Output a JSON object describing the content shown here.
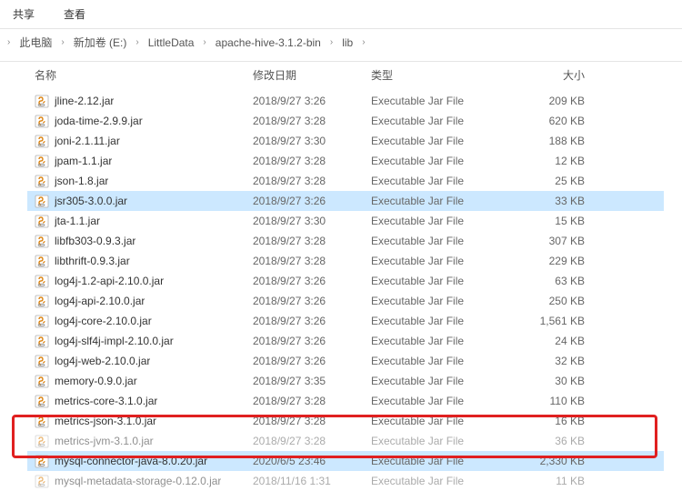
{
  "menubar": [
    {
      "label": "共享"
    },
    {
      "label": "查看"
    }
  ],
  "breadcrumb": [
    "此电脑",
    "新加卷 (E:)",
    "LittleData",
    "apache-hive-3.1.2-bin",
    "lib"
  ],
  "columns": {
    "name": "名称",
    "date": "修改日期",
    "type": "类型",
    "size": "大小"
  },
  "files": [
    {
      "name": "jline-2.12.jar",
      "date": "2018/9/27 3:26",
      "type": "Executable Jar File",
      "size": "209 KB",
      "selected": false
    },
    {
      "name": "joda-time-2.9.9.jar",
      "date": "2018/9/27 3:28",
      "type": "Executable Jar File",
      "size": "620 KB",
      "selected": false
    },
    {
      "name": "joni-2.1.11.jar",
      "date": "2018/9/27 3:30",
      "type": "Executable Jar File",
      "size": "188 KB",
      "selected": false
    },
    {
      "name": "jpam-1.1.jar",
      "date": "2018/9/27 3:28",
      "type": "Executable Jar File",
      "size": "12 KB",
      "selected": false
    },
    {
      "name": "json-1.8.jar",
      "date": "2018/9/27 3:28",
      "type": "Executable Jar File",
      "size": "25 KB",
      "selected": false
    },
    {
      "name": "jsr305-3.0.0.jar",
      "date": "2018/9/27 3:26",
      "type": "Executable Jar File",
      "size": "33 KB",
      "selected": true
    },
    {
      "name": "jta-1.1.jar",
      "date": "2018/9/27 3:30",
      "type": "Executable Jar File",
      "size": "15 KB",
      "selected": false
    },
    {
      "name": "libfb303-0.9.3.jar",
      "date": "2018/9/27 3:28",
      "type": "Executable Jar File",
      "size": "307 KB",
      "selected": false
    },
    {
      "name": "libthrift-0.9.3.jar",
      "date": "2018/9/27 3:28",
      "type": "Executable Jar File",
      "size": "229 KB",
      "selected": false
    },
    {
      "name": "log4j-1.2-api-2.10.0.jar",
      "date": "2018/9/27 3:26",
      "type": "Executable Jar File",
      "size": "63 KB",
      "selected": false
    },
    {
      "name": "log4j-api-2.10.0.jar",
      "date": "2018/9/27 3:26",
      "type": "Executable Jar File",
      "size": "250 KB",
      "selected": false
    },
    {
      "name": "log4j-core-2.10.0.jar",
      "date": "2018/9/27 3:26",
      "type": "Executable Jar File",
      "size": "1,561 KB",
      "selected": false
    },
    {
      "name": "log4j-slf4j-impl-2.10.0.jar",
      "date": "2018/9/27 3:26",
      "type": "Executable Jar File",
      "size": "24 KB",
      "selected": false
    },
    {
      "name": "log4j-web-2.10.0.jar",
      "date": "2018/9/27 3:26",
      "type": "Executable Jar File",
      "size": "32 KB",
      "selected": false
    },
    {
      "name": "memory-0.9.0.jar",
      "date": "2018/9/27 3:35",
      "type": "Executable Jar File",
      "size": "30 KB",
      "selected": false
    },
    {
      "name": "metrics-core-3.1.0.jar",
      "date": "2018/9/27 3:28",
      "type": "Executable Jar File",
      "size": "110 KB",
      "selected": false
    },
    {
      "name": "metrics-json-3.1.0.jar",
      "date": "2018/9/27 3:28",
      "type": "Executable Jar File",
      "size": "16 KB",
      "selected": false
    },
    {
      "name": "metrics-jvm-3.1.0.jar",
      "date": "2018/9/27 3:28",
      "type": "Executable Jar File",
      "size": "36 KB",
      "selected": false,
      "faded": true
    },
    {
      "name": "mysql-connector-java-8.0.20.jar",
      "date": "2020/6/5 23:46",
      "type": "Executable Jar File",
      "size": "2,330 KB",
      "selected": true
    },
    {
      "name": "mysql-metadata-storage-0.12.0.jar",
      "date": "2018/11/16 1:31",
      "type": "Executable Jar File",
      "size": "11 KB",
      "selected": false,
      "faded": true
    }
  ]
}
